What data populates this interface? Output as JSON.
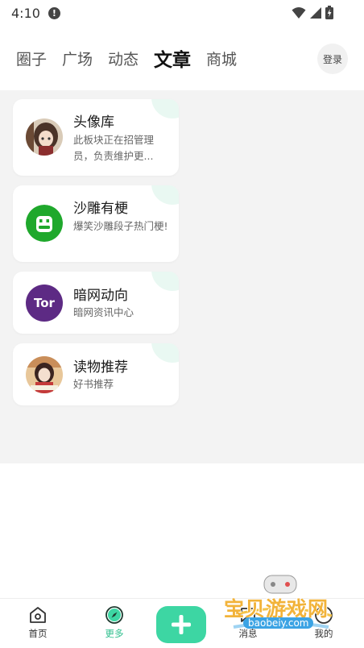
{
  "status_bar": {
    "time": "4:10",
    "alert_glyph": "!"
  },
  "top_tabs": [
    {
      "label": "圈子",
      "active": false
    },
    {
      "label": "广场",
      "active": false
    },
    {
      "label": "动态",
      "active": false
    },
    {
      "label": "文章",
      "active": true
    },
    {
      "label": "商城",
      "active": false
    }
  ],
  "header": {
    "login_label": "登录"
  },
  "cards": [
    {
      "title": "头像库",
      "description": "此板块正在招管理员，负责维护更...",
      "avatar_icon": "anime-girl-avatar-icon"
    },
    {
      "title": "沙雕有梗",
      "description": "爆笑沙雕段子热门梗!",
      "avatar_icon": "green-face-avatar-icon"
    },
    {
      "title": "暗网动向",
      "description": "暗网资讯中心",
      "avatar_icon": "tor-logo-icon",
      "avatar_text": "Tor"
    },
    {
      "title": "读物推荐",
      "description": "好书推荐",
      "avatar_icon": "reading-girl-avatar-icon"
    }
  ],
  "bottom_nav": {
    "home_label": "首页",
    "more_label": "更多",
    "messages_label": "消息",
    "mine_label": "我的",
    "active": "更多",
    "fab_icon": "plus-icon"
  },
  "watermark": {
    "title": "宝贝游戏网",
    "url": "baobeiy.com"
  },
  "colors": {
    "accent": "#3dd6a3",
    "active_nav": "#2fbf8e",
    "content_bg": "#f3f3f3",
    "card_corner": "#e9f8f2"
  }
}
